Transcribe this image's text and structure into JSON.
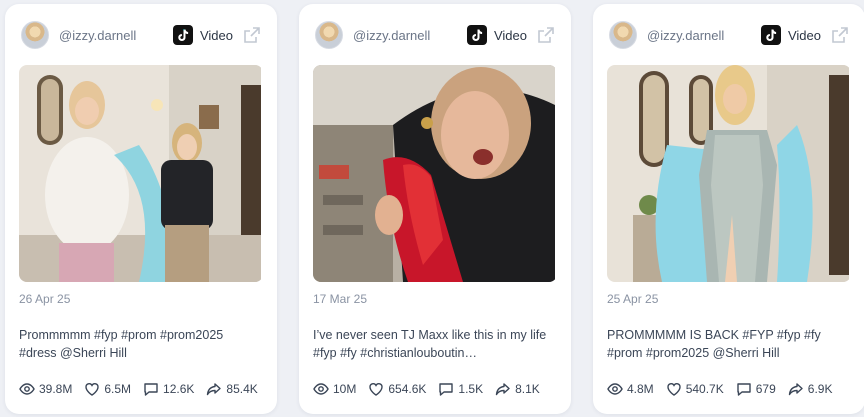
{
  "cards": [
    {
      "handle": "@izzy.darnell",
      "platform_icon": "tiktok-icon",
      "type_label": "Video",
      "date": "26 Apr 25",
      "caption": "Prommmmm #fyp #prom #prom2025 #dress @Sherri Hill",
      "views": "39.8M",
      "likes": "6.5M",
      "comments": "12.6K",
      "shares": "85.4K"
    },
    {
      "handle": "@izzy.darnell",
      "platform_icon": "tiktok-icon",
      "type_label": "Video",
      "date": "17 Mar 25",
      "caption": "I’ve never seen TJ Maxx like this in my life #fyp #fy #christianlouboutin…",
      "views": "10M",
      "likes": "654.6K",
      "comments": "1.5K",
      "shares": "8.1K"
    },
    {
      "handle": "@izzy.darnell",
      "platform_icon": "tiktok-icon",
      "type_label": "Video",
      "date": "25 Apr 25",
      "caption": "PROMMMMM IS BACK #FYP #fyp #fy #prom #prom2025 @Sherri Hill",
      "views": "4.8M",
      "likes": "540.7K",
      "comments": "679",
      "shares": "6.9K"
    }
  ],
  "stat_icons": [
    "eye-icon",
    "heart-icon",
    "comment-icon",
    "share-icon"
  ],
  "colors": {
    "background": "#eef0f5",
    "card": "#ffffff",
    "text": "#3b4657",
    "muted": "#8a93a3"
  }
}
